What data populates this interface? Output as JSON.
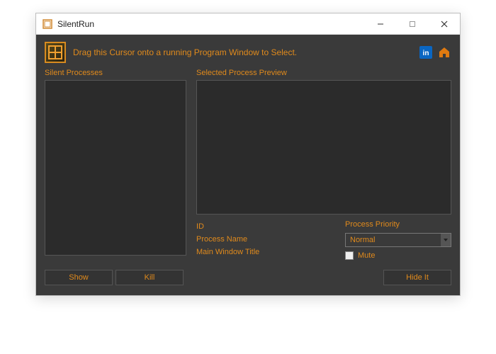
{
  "titlebar": {
    "title": "SilentRun"
  },
  "top": {
    "hint": "Drag this Cursor onto a running Program Window to Select."
  },
  "labels": {
    "silent_processes": "Silent Processes",
    "selected_preview": "Selected Process Preview",
    "id": "ID",
    "process_name": "Process Name",
    "main_window_title": "Main Window Title",
    "process_priority": "Process Priority",
    "mute": "Mute"
  },
  "priority": {
    "value": "Normal"
  },
  "buttons": {
    "show": "Show",
    "kill": "Kill",
    "hide_it": "Hide It"
  }
}
